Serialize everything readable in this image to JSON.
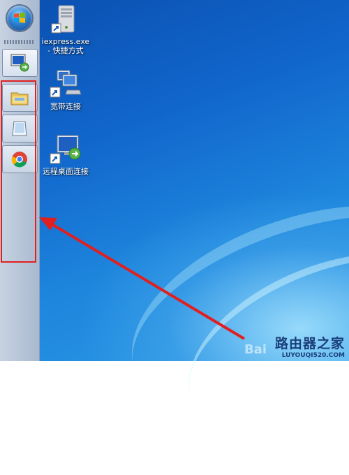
{
  "desktop": {
    "icons": [
      {
        "label": "iexpress.exe - 快捷方式",
        "line1": "iexpress.exe",
        "line2": "- 快捷方式"
      },
      {
        "label": "宽带连接"
      },
      {
        "label": "远程桌面连接"
      }
    ]
  },
  "taskbar": {
    "orientation": "vertical",
    "pinned": [
      {
        "name": "remote-desktop"
      },
      {
        "name": "windows-explorer"
      },
      {
        "name": "notepad"
      },
      {
        "name": "chrome"
      }
    ]
  },
  "watermark": {
    "title": "路由器之家",
    "url": "LUYOUQI520.COM",
    "logo": "Bai"
  },
  "colors": {
    "annotation": "#e02020",
    "wallpaper": "#1166cc"
  }
}
